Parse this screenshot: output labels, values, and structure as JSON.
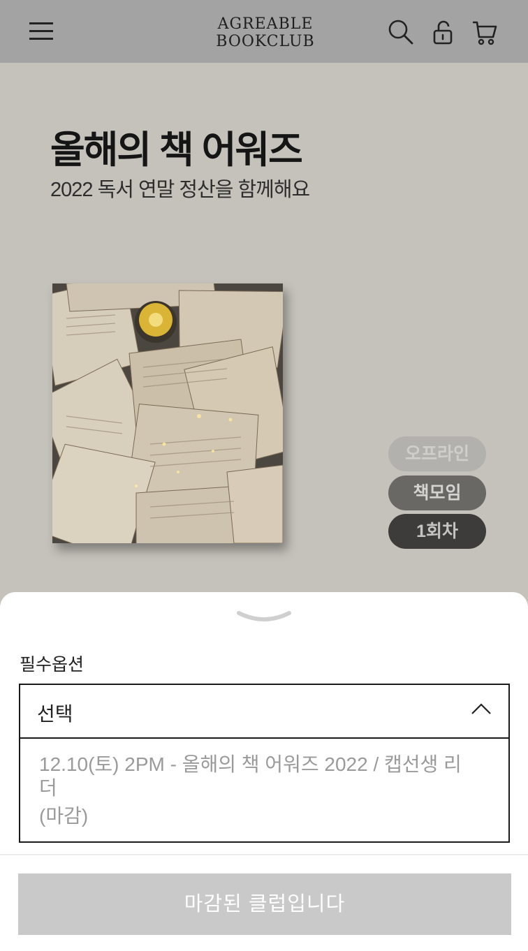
{
  "header": {
    "logo_line1": "AGREABLE",
    "logo_line2": "BOOKCLUB",
    "icons": [
      "menu-icon",
      "search-icon",
      "lock-icon",
      "cart-icon"
    ]
  },
  "hero": {
    "title": "올해의 책 어워즈",
    "subtitle": "2022 독서 연말 정산을 함께해요",
    "tags": [
      "오프라인",
      "책모임",
      "1회차"
    ]
  },
  "sheet": {
    "option_label": "필수옵션",
    "select_value": "선택",
    "option_text": "12.10(토) 2PM - 올해의 책 어워즈 2022 / 캡선생 리더",
    "option_status": "(마감)",
    "cta_label": "마감된 클럽입니다"
  },
  "colors": {
    "header_bg": "#a3a3a3",
    "hero_bg": "#c5c2bb",
    "cta_bg": "#c9c9c9"
  }
}
